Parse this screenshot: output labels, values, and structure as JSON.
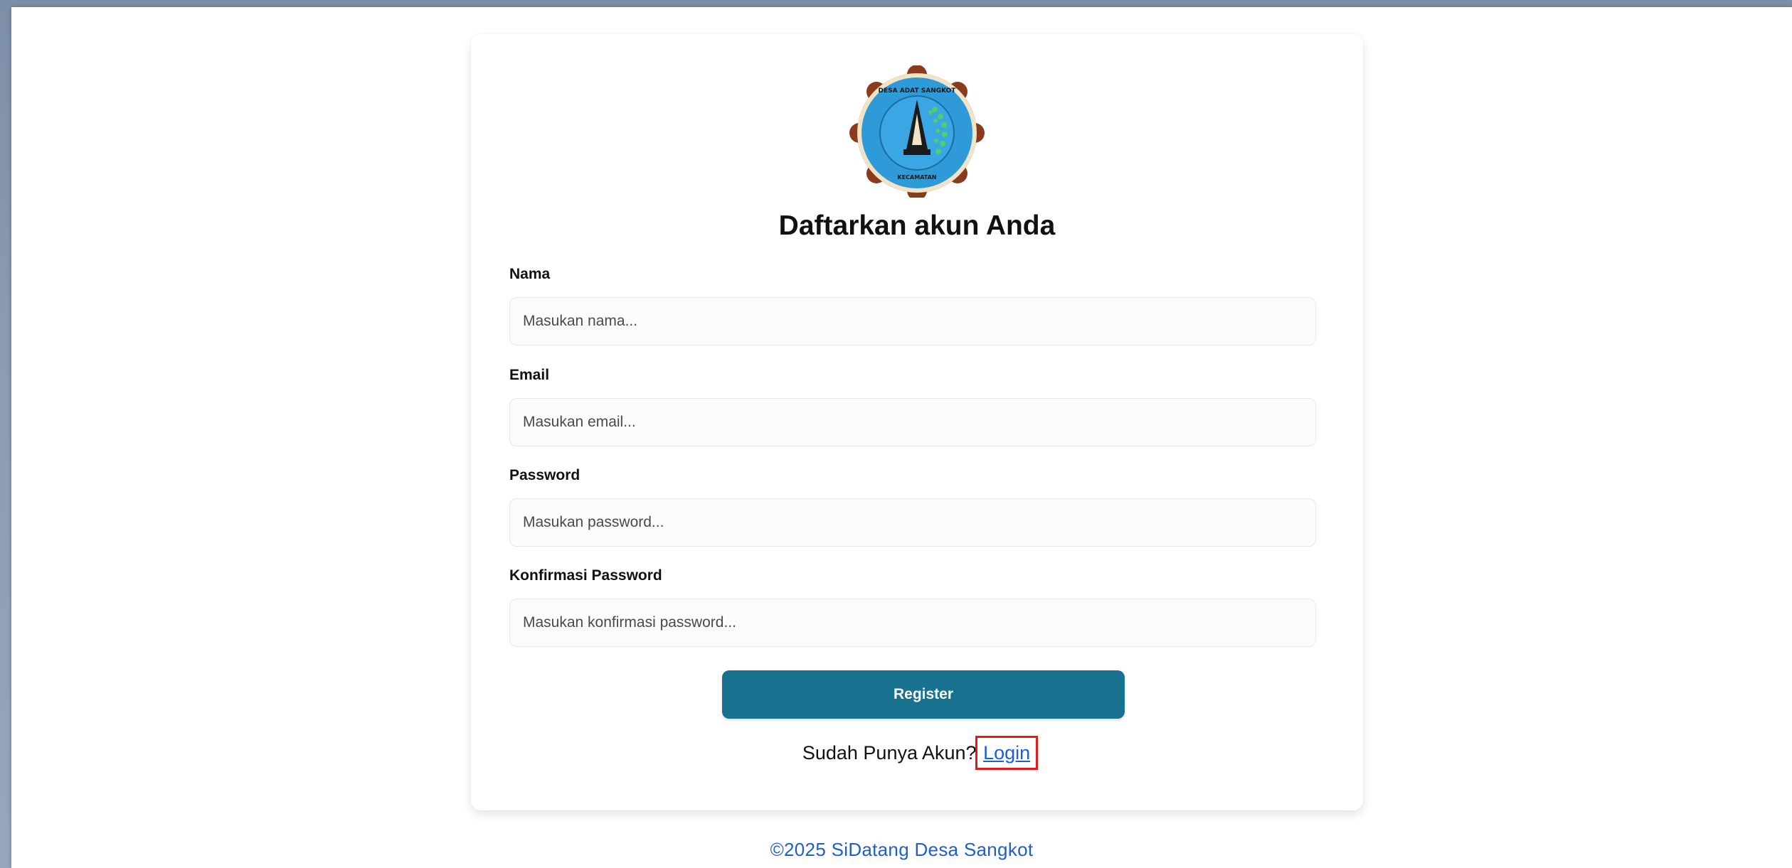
{
  "logo": {
    "icon": "village-emblem-icon",
    "top_text": "DESA ADAT SANGKOT",
    "bottom_text": "KECAMATAN",
    "colors": {
      "shield": "#2f9ad8",
      "border": "#8a3b1e",
      "accent": "#f3e21b"
    }
  },
  "form": {
    "title": "Daftarkan akun Anda",
    "fields": [
      {
        "label": "Nama",
        "placeholder": "Masukan nama..."
      },
      {
        "label": "Email",
        "placeholder": "Masukan email..."
      },
      {
        "label": "Password",
        "placeholder": "Masukan password..."
      },
      {
        "label": "Konfirmasi Password",
        "placeholder": "Masukan konfirmasi password..."
      }
    ],
    "register_label": "Register",
    "has_account_text": "Sudah Punya Akun?",
    "login_label": "Login"
  },
  "footer": {
    "copyright": "©2025 SiDatang Desa Sangkot"
  },
  "colors": {
    "primary_button": "#17718f",
    "link": "#1a5ed8",
    "highlight": "#e01b1b"
  }
}
